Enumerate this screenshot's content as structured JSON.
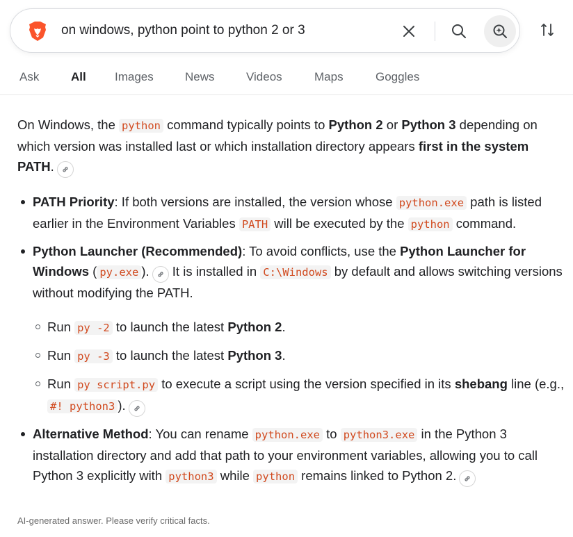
{
  "search": {
    "query": "on windows, python point to python 2 or 3"
  },
  "icons": {
    "logo": "brave-lion-logo",
    "clear": "close-icon",
    "search": "search-icon",
    "ai": "ai-sparkle-search-icon",
    "filter": "sort-filter-icon",
    "cite": "link-icon"
  },
  "colors": {
    "brand": "#fb542b",
    "code_text": "#d14a1f",
    "code_bg": "#f3f3f3"
  },
  "tabs": [
    {
      "label": "Ask",
      "active": false
    },
    {
      "label": "All",
      "active": true
    },
    {
      "label": "Images",
      "active": false
    },
    {
      "label": "News",
      "active": false
    },
    {
      "label": "Videos",
      "active": false
    },
    {
      "label": "Maps",
      "active": false
    },
    {
      "label": "Goggles",
      "active": false
    }
  ],
  "answer": {
    "intro": {
      "t1": "On Windows, the ",
      "c1": "python",
      "t2": " command typically points to ",
      "b1": "Python 2",
      "t3": " or ",
      "b2": "Python 3",
      "t4": " depending on which version was installed last or which installation directory appears ",
      "b3": "first in the system PATH",
      "t5": "."
    },
    "path_priority": {
      "b1": "PATH Priority",
      "t1": ": If both versions are installed, the version whose ",
      "c1": "python.exe",
      "t2": " path is listed earlier in the Environment Variables ",
      "c2": "PATH",
      "t3": " will be executed by the ",
      "c3": "python",
      "t4": " command."
    },
    "launcher": {
      "b1": "Python Launcher (Recommended)",
      "t1": ": To avoid conflicts, use the ",
      "b2": "Python Launcher for Windows",
      "t2": " (",
      "c1": "py.exe",
      "t3": ").",
      "t4": " It is installed in ",
      "c2": "C:\\Windows",
      "t5": " by default and allows switching versions without modifying the PATH.",
      "sub": [
        {
          "t1": "Run ",
          "c1": "py -2",
          "t2": " to launch the latest ",
          "b1": "Python 2",
          "t3": "."
        },
        {
          "t1": "Run ",
          "c1": "py -3",
          "t2": " to launch the latest ",
          "b1": "Python 3",
          "t3": "."
        },
        {
          "t1": "Run ",
          "c1": "py script.py",
          "t2": " to execute a script using the version specified in its ",
          "b1": "shebang",
          "t3": " line (e.g., ",
          "c2": "#! python3",
          "t4": ")."
        }
      ]
    },
    "alternative": {
      "b1": "Alternative Method",
      "t1": ": You can rename ",
      "c1": "python.exe",
      "t2": " to ",
      "c2": "python3.exe",
      "t3": " in the Python 3 installation directory and add that path to your environment variables, allowing you to call Python 3 explicitly with ",
      "c3": "python3",
      "t4": " while ",
      "c4": "python",
      "t5": " remains linked to Python 2."
    }
  },
  "disclaimer": "AI-generated answer. Please verify critical facts."
}
